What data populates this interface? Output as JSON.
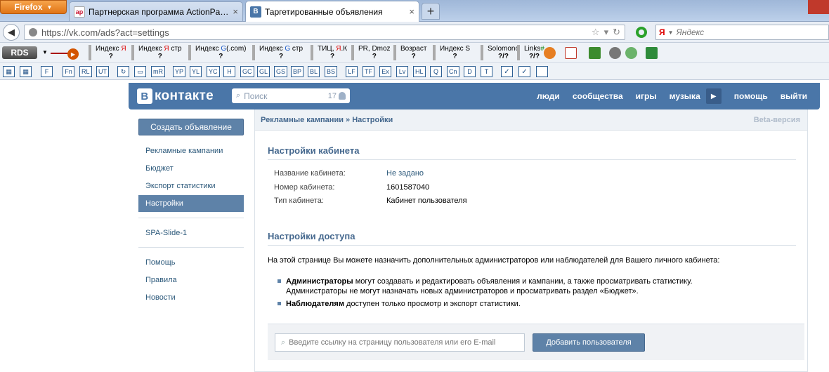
{
  "browser": {
    "firefox_label": "Firefox",
    "tabs": [
      {
        "favicon": "ap",
        "title": "Партнерская программа ActionPay...",
        "close": "×"
      },
      {
        "favicon": "В",
        "title": "Таргетированные объявления",
        "close": "×"
      }
    ],
    "new_tab": "+",
    "url": "https://vk.com/ads?act=settings",
    "search_engine": "Я",
    "search_placeholder": "Яндекс"
  },
  "rds": {
    "logo": "RDS",
    "items": [
      {
        "label_pre": "Индекс ",
        "label_hl": "Я",
        "hl_color": "red",
        "label_post": "",
        "value": "?"
      },
      {
        "label_pre": "Индекс ",
        "label_hl": "Я",
        "hl_color": "red",
        "label_post": " стр",
        "value": "?"
      },
      {
        "label_pre": "Индекс ",
        "label_hl": "G",
        "hl_color": "blue",
        "label_post": "(.com)",
        "value": "?"
      },
      {
        "label_pre": "Индекс ",
        "label_hl": "G",
        "hl_color": "blue",
        "label_post": " стр",
        "value": "?"
      },
      {
        "label_pre": "ТИЦ, ",
        "label_hl": "Я",
        "hl_color": "red",
        "label_post": ".К",
        "value": "?"
      },
      {
        "label_pre": "PR, Dmoz",
        "label_hl": "",
        "hl_color": "",
        "label_post": "",
        "value": "?"
      },
      {
        "label_pre": "Возраст",
        "label_hl": "",
        "hl_color": "",
        "label_post": "",
        "value": "?"
      },
      {
        "label_pre": "Индекс S",
        "label_hl": "",
        "hl_color": "",
        "label_post": "",
        "value": "?"
      },
      {
        "label_pre": "Solomono",
        "label_hl": "",
        "hl_color": "",
        "label_post": "",
        "value": "?/?"
      },
      {
        "label_pre": "Links",
        "label_hl": "#",
        "hl_color": "green",
        "label_post": "",
        "value": "?/?"
      }
    ]
  },
  "buttons_bar": [
    "F",
    "Fn",
    "RL",
    "UT",
    "↻",
    "▭",
    "mR",
    "YP",
    "YL",
    "YC",
    "H",
    "GC",
    "GL",
    "GS",
    "BP",
    "BL",
    "BS",
    "LF",
    "TF",
    "Ex",
    "Lv",
    "HL",
    "Q",
    "Cn",
    "D",
    "T",
    "✓",
    "✓",
    ""
  ],
  "vk": {
    "logo_letter": "В",
    "logo_text": "контакте",
    "search_placeholder": "Поиск",
    "search_count": "17",
    "nav": [
      "люди",
      "сообщества",
      "игры",
      "музыка",
      "помощь",
      "выйти"
    ]
  },
  "menu": {
    "create_ad": "Создать объявление",
    "items": [
      "Рекламные кампании",
      "Бюджет",
      "Экспорт статистики",
      "Настройки"
    ],
    "app": "SPA-Slide-1",
    "footer": [
      "Помощь",
      "Правила",
      "Новости"
    ]
  },
  "content": {
    "breadcrumb": "Рекламные кампании » Настройки",
    "beta": "Beta-версия",
    "cabinet_title": "Настройки кабинета",
    "cabinet_fields": [
      {
        "key": "Название кабинета:",
        "value": "Не задано"
      },
      {
        "key": "Номер кабинета:",
        "value": "1601587040"
      },
      {
        "key": "Тип кабинета:",
        "value": "Кабинет пользователя"
      }
    ],
    "access_title": "Настройки доступа",
    "access_desc": "На этой странице Вы можете назначить дополнительных администраторов или наблюдателей для Вашего личного кабинета:",
    "bullets": [
      {
        "bold": "Администраторы",
        "text": " могут создавать и редактировать объявления и кампании, а также просматривать статистику.",
        "text2": "Администраторы не могут назначать новых администраторов и просматривать раздел «Бюджет»."
      },
      {
        "bold": "Наблюдателям",
        "text": " доступен только просмотр и экспорт статистики.",
        "text2": ""
      }
    ],
    "user_input_placeholder": "Введите ссылку на страницу пользователя или его E-mail",
    "add_user_button": "Добавить пользователя"
  }
}
